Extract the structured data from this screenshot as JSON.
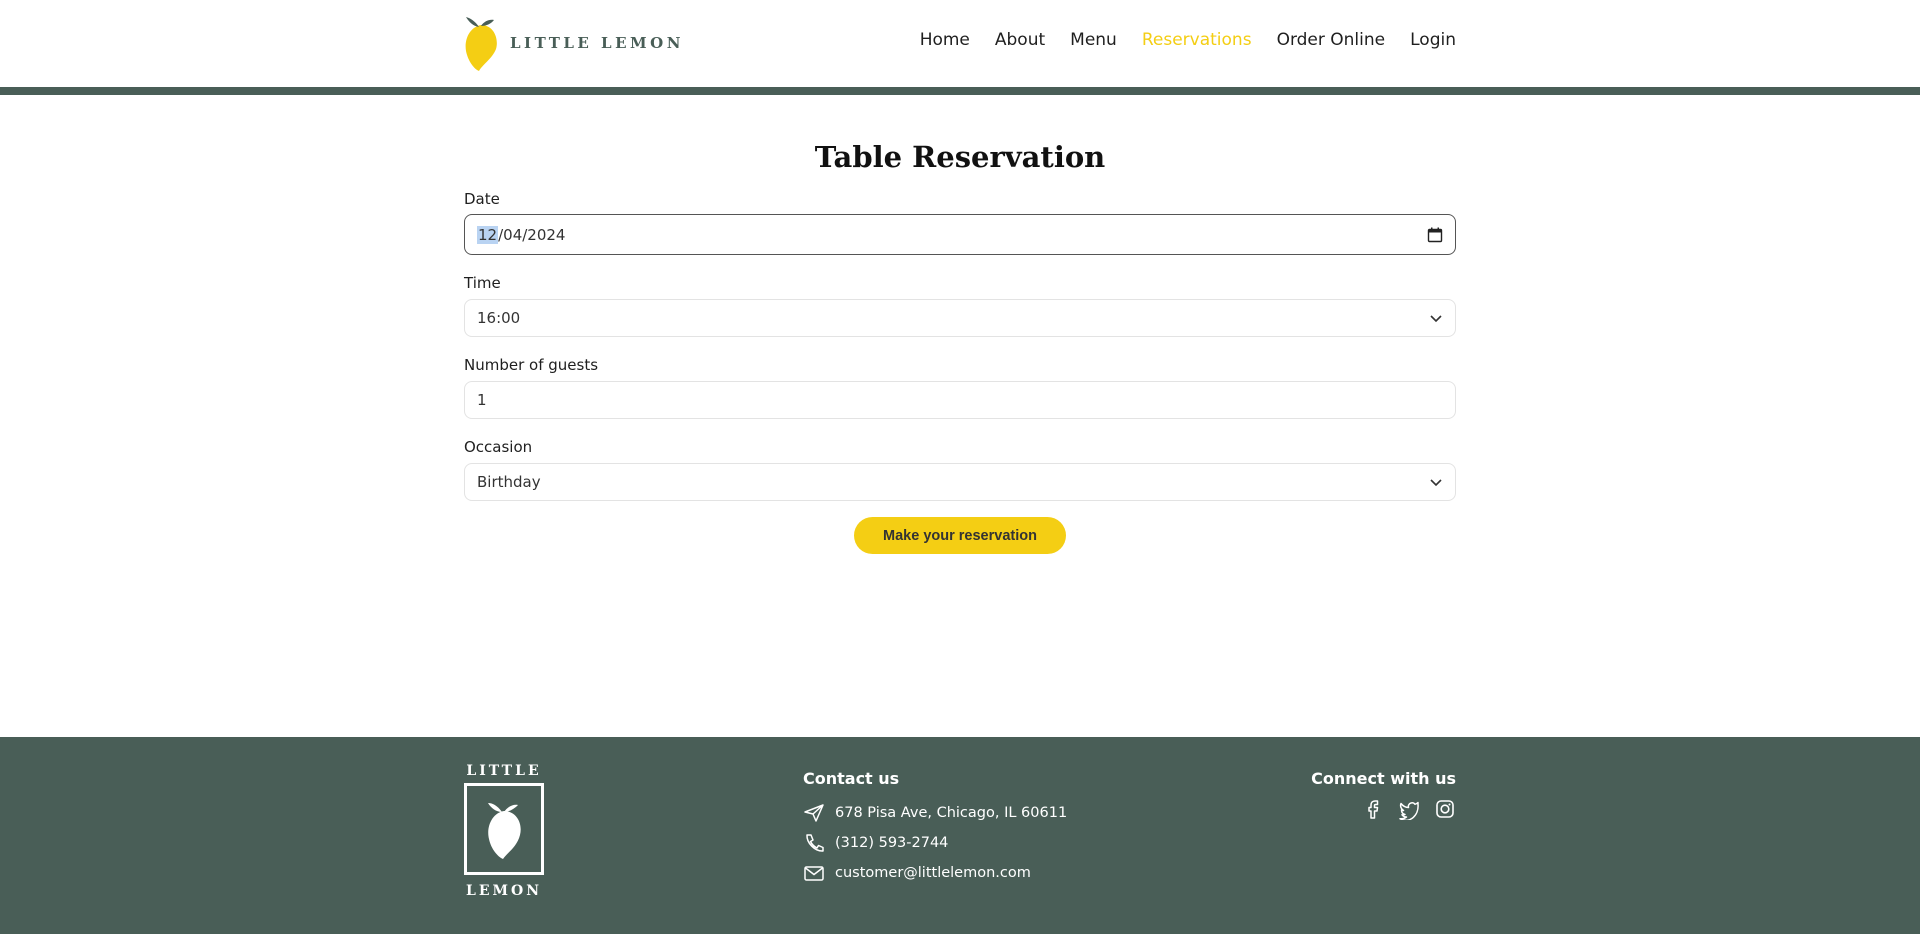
{
  "header": {
    "logo_text": "LITTLE LEMON",
    "nav": [
      {
        "label": "Home",
        "active": false
      },
      {
        "label": "About",
        "active": false
      },
      {
        "label": "Menu",
        "active": false
      },
      {
        "label": "Reservations",
        "active": true
      },
      {
        "label": "Order Online",
        "active": false
      },
      {
        "label": "Login",
        "active": false
      }
    ]
  },
  "form": {
    "title": "Table Reservation",
    "date": {
      "label": "Date",
      "month": "12",
      "rest": "/04/2024",
      "icon": "calendar-icon"
    },
    "time": {
      "label": "Time",
      "value": "16:00",
      "icon": "chevron-down-icon"
    },
    "guests": {
      "label": "Number of guests",
      "value": "1"
    },
    "occasion": {
      "label": "Occasion",
      "value": "Birthday",
      "icon": "chevron-down-icon"
    },
    "submit_label": "Make your reservation"
  },
  "footer": {
    "logo_top": "LITTLE",
    "logo_bottom": "LEMON",
    "contact": {
      "heading": "Contact us",
      "address": "678 Pisa Ave, Chicago, IL 60611",
      "phone": "(312) 593-2744",
      "email": "customer@littlelemon.com"
    },
    "connect": {
      "heading": "Connect with us",
      "icons": [
        "facebook-icon",
        "twitter-icon",
        "instagram-icon"
      ]
    }
  },
  "colors": {
    "accent": "#F4CE14",
    "brand_green": "#495E57"
  }
}
